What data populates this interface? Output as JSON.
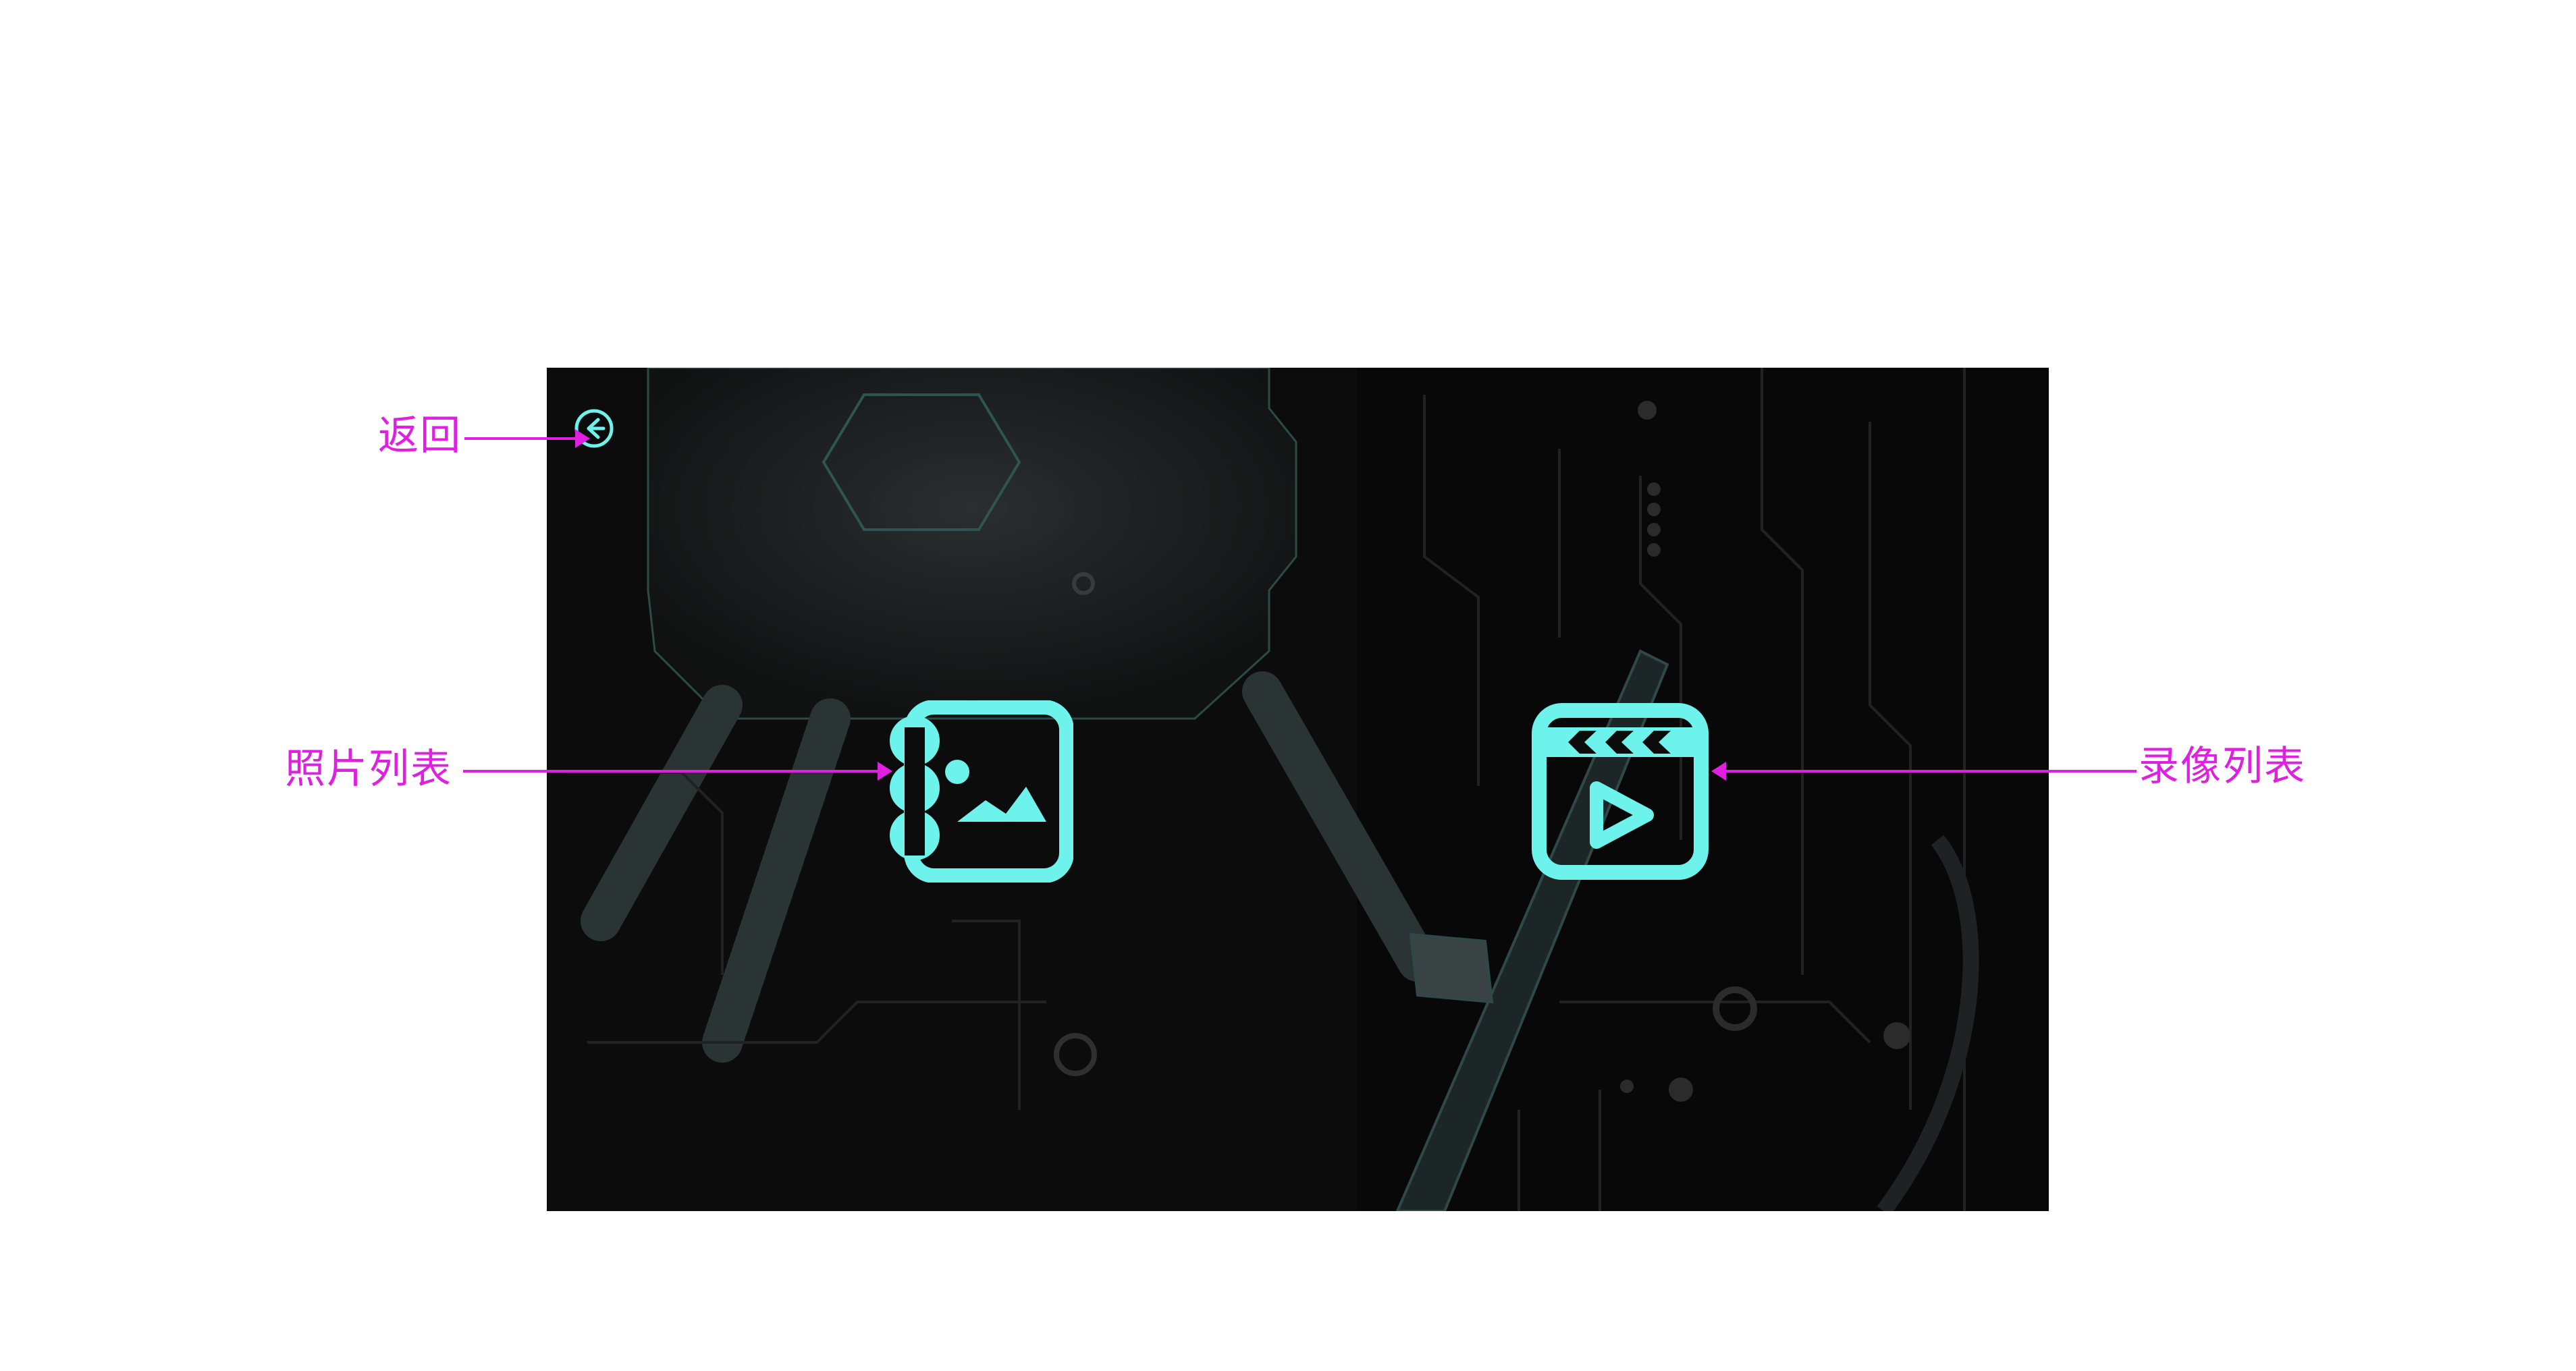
{
  "annotations": {
    "back": "返回",
    "photo_list": "照片列表",
    "video_list": "录像列表"
  },
  "icons": {
    "back": "back-arrow-circle-icon",
    "photo": "photo-album-icon",
    "video": "video-clapper-play-icon"
  },
  "colors": {
    "accent": "#6ef2ec",
    "annotation": "#e020e0",
    "background": "#0c0c0c"
  }
}
